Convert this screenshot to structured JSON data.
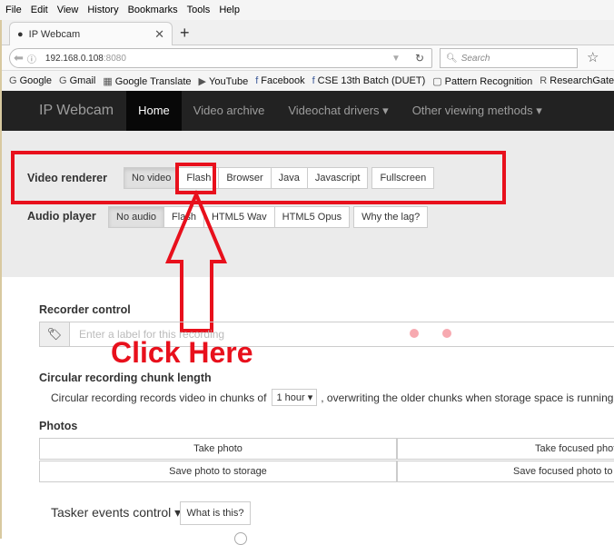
{
  "browser": {
    "menu": [
      "File",
      "Edit",
      "View",
      "History",
      "Bookmarks",
      "Tools",
      "Help"
    ],
    "tab_title": "IP Webcam",
    "url_host": "192.168.0.108",
    "url_port": ":8080",
    "search_placeholder": "Search",
    "bookmarks": [
      "Google",
      "Gmail",
      "Google Translate",
      "YouTube",
      "Facebook",
      "CSE 13th Batch (DUET)",
      "Pattern Recognition",
      "ResearchGate"
    ]
  },
  "nav": {
    "brand": "IP Webcam",
    "items": [
      "Home",
      "Video archive",
      "Videochat drivers ▾",
      "Other viewing methods ▾"
    ]
  },
  "video_renderer": {
    "label": "Video renderer",
    "options": [
      "No video",
      "Flash",
      "Browser",
      "Java",
      "Javascript"
    ],
    "fullscreen": "Fullscreen"
  },
  "audio_player": {
    "label": "Audio player",
    "options": [
      "No audio",
      "Flash",
      "HTML5 Wav",
      "HTML5 Opus"
    ],
    "why": "Why the lag?"
  },
  "annotation": {
    "text": "Click Here",
    "color": "#e8101c"
  },
  "recorder": {
    "title": "Recorder control",
    "placeholder": "Enter a label for this recording"
  },
  "circular": {
    "title": "Circular recording chunk length",
    "text_before": "Circular recording records video in chunks of",
    "select": "1 hour ▾",
    "text_after": ", overwriting the older chunks when storage space is running o"
  },
  "photos": {
    "title": "Photos",
    "buttons": [
      "Take photo",
      "Take focused photo",
      "Save photo to storage",
      "Save focused photo to st"
    ]
  },
  "tasker": {
    "title": "Tasker events control ▾",
    "help": "What is this?"
  }
}
